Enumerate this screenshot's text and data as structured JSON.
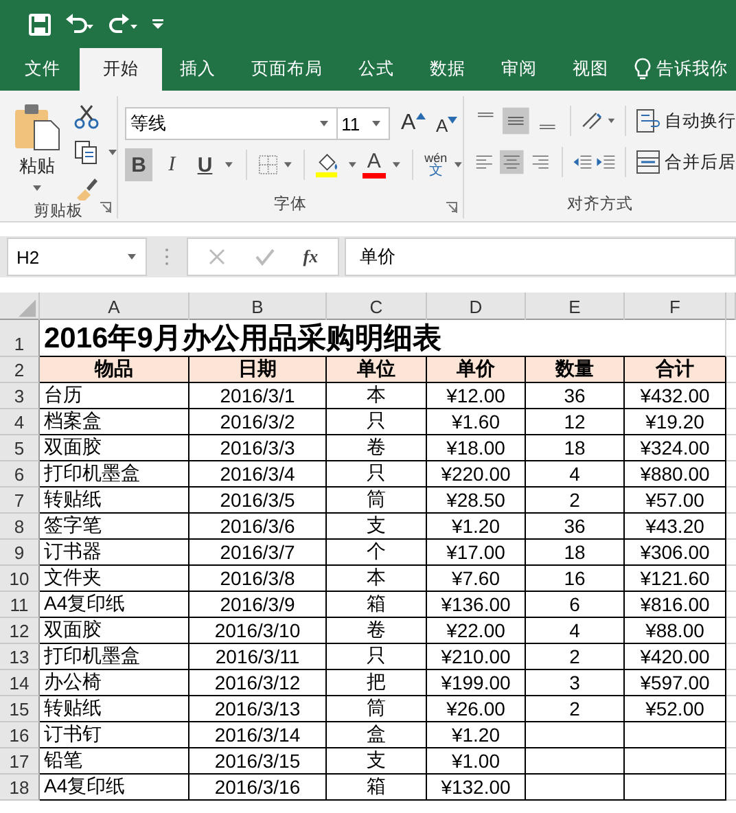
{
  "tabs": [
    {
      "label": "文件",
      "selected": false
    },
    {
      "label": "开始",
      "selected": true
    },
    {
      "label": "插入",
      "selected": false
    },
    {
      "label": "页面布局",
      "selected": false
    },
    {
      "label": "公式",
      "selected": false
    },
    {
      "label": "数据",
      "selected": false
    },
    {
      "label": "审阅",
      "selected": false
    },
    {
      "label": "视图",
      "selected": false
    }
  ],
  "tell_me": "告诉我你",
  "ribbon": {
    "clipboard": {
      "paste_label": "粘贴",
      "label": "剪贴板"
    },
    "font": {
      "font_name": "等线",
      "font_size": "11",
      "grow_label": "A",
      "shrink_label": "A",
      "styles": [
        {
          "kind": "bold",
          "label": "B",
          "selected": true
        },
        {
          "kind": "italic",
          "label": "I",
          "selected": false
        },
        {
          "kind": "underline",
          "label": "U",
          "selected": false
        }
      ],
      "font_color_label": "A",
      "phonetic_top": "wén",
      "phonetic_bottom": "文",
      "label": "字体"
    },
    "alignment": {
      "vertical": [
        {
          "kind": "top",
          "selected": false
        },
        {
          "kind": "middle",
          "selected": true
        },
        {
          "kind": "bottom",
          "selected": false
        }
      ],
      "horizontal": [
        {
          "kind": "left",
          "selected": false
        },
        {
          "kind": "center",
          "selected": true
        },
        {
          "kind": "right",
          "selected": false
        }
      ],
      "wrap_text": "自动换行",
      "merge": "合并后居",
      "label": "对齐方式"
    }
  },
  "name_box": "H2",
  "function_button": "fx",
  "formula": "单价",
  "sheet": {
    "columns": [
      "A",
      "B",
      "C",
      "D",
      "E",
      "F"
    ],
    "title_row": "1",
    "title": "2016年9月办公用品采购明细表",
    "header_row": "2",
    "header": [
      "物品",
      "日期",
      "单位",
      "单价",
      "数量",
      "合计"
    ],
    "rows": [
      {
        "row": "3",
        "item": "台历",
        "date": "2016/3/1",
        "unit": "本",
        "price": "¥12.00",
        "qty": "36",
        "total": "¥432.00"
      },
      {
        "row": "4",
        "item": "档案盒",
        "date": "2016/3/2",
        "unit": "只",
        "price": "¥1.60",
        "qty": "12",
        "total": "¥19.20"
      },
      {
        "row": "5",
        "item": "双面胶",
        "date": "2016/3/3",
        "unit": "卷",
        "price": "¥18.00",
        "qty": "18",
        "total": "¥324.00"
      },
      {
        "row": "6",
        "item": "打印机墨盒",
        "date": "2016/3/4",
        "unit": "只",
        "price": "¥220.00",
        "qty": "4",
        "total": "¥880.00"
      },
      {
        "row": "7",
        "item": "转贴纸",
        "date": "2016/3/5",
        "unit": "筒",
        "price": "¥28.50",
        "qty": "2",
        "total": "¥57.00"
      },
      {
        "row": "8",
        "item": "签字笔",
        "date": "2016/3/6",
        "unit": "支",
        "price": "¥1.20",
        "qty": "36",
        "total": "¥43.20"
      },
      {
        "row": "9",
        "item": "订书器",
        "date": "2016/3/7",
        "unit": "个",
        "price": "¥17.00",
        "qty": "18",
        "total": "¥306.00"
      },
      {
        "row": "10",
        "item": "文件夹",
        "date": "2016/3/8",
        "unit": "本",
        "price": "¥7.60",
        "qty": "16",
        "total": "¥121.60"
      },
      {
        "row": "11",
        "item": "A4复印纸",
        "date": "2016/3/9",
        "unit": "箱",
        "price": "¥136.00",
        "qty": "6",
        "total": "¥816.00"
      },
      {
        "row": "12",
        "item": "双面胶",
        "date": "2016/3/10",
        "unit": "卷",
        "price": "¥22.00",
        "qty": "4",
        "total": "¥88.00"
      },
      {
        "row": "13",
        "item": "打印机墨盒",
        "date": "2016/3/11",
        "unit": "只",
        "price": "¥210.00",
        "qty": "2",
        "total": "¥420.00"
      },
      {
        "row": "14",
        "item": "办公椅",
        "date": "2016/3/12",
        "unit": "把",
        "price": "¥199.00",
        "qty": "3",
        "total": "¥597.00"
      },
      {
        "row": "15",
        "item": "转贴纸",
        "date": "2016/3/13",
        "unit": "筒",
        "price": "¥26.00",
        "qty": "2",
        "total": "¥52.00"
      },
      {
        "row": "16",
        "item": "订书钉",
        "date": "2016/3/14",
        "unit": "盒",
        "price": "¥1.20"
      },
      {
        "row": "17",
        "item": "铅笔",
        "date": "2016/3/15",
        "unit": "支",
        "price": "¥1.00"
      },
      {
        "row": "18",
        "item": "A4复印纸",
        "date": "2016/3/16",
        "unit": "箱",
        "price": "¥132.00"
      }
    ]
  }
}
